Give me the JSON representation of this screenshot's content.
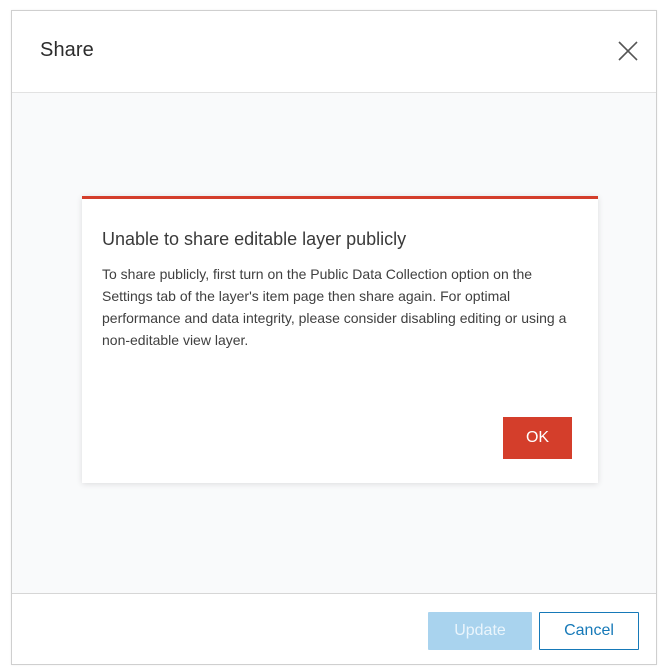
{
  "dialog": {
    "title": "Share",
    "close_icon": "close-icon"
  },
  "alert": {
    "title": "Unable to share editable layer publicly",
    "message": "To share publicly, first turn on the Public Data Collection option on the Settings tab of the layer's item page then share again. For optimal performance and data integrity, please consider disabling editing or using a non-editable view layer.",
    "ok_label": "OK",
    "accent_color": "#d43e2b"
  },
  "footer": {
    "update_label": "Update",
    "cancel_label": "Cancel"
  },
  "colors": {
    "primary": "#1679b8",
    "primary_disabled": "#a9d3ee",
    "danger": "#d43e2b"
  }
}
